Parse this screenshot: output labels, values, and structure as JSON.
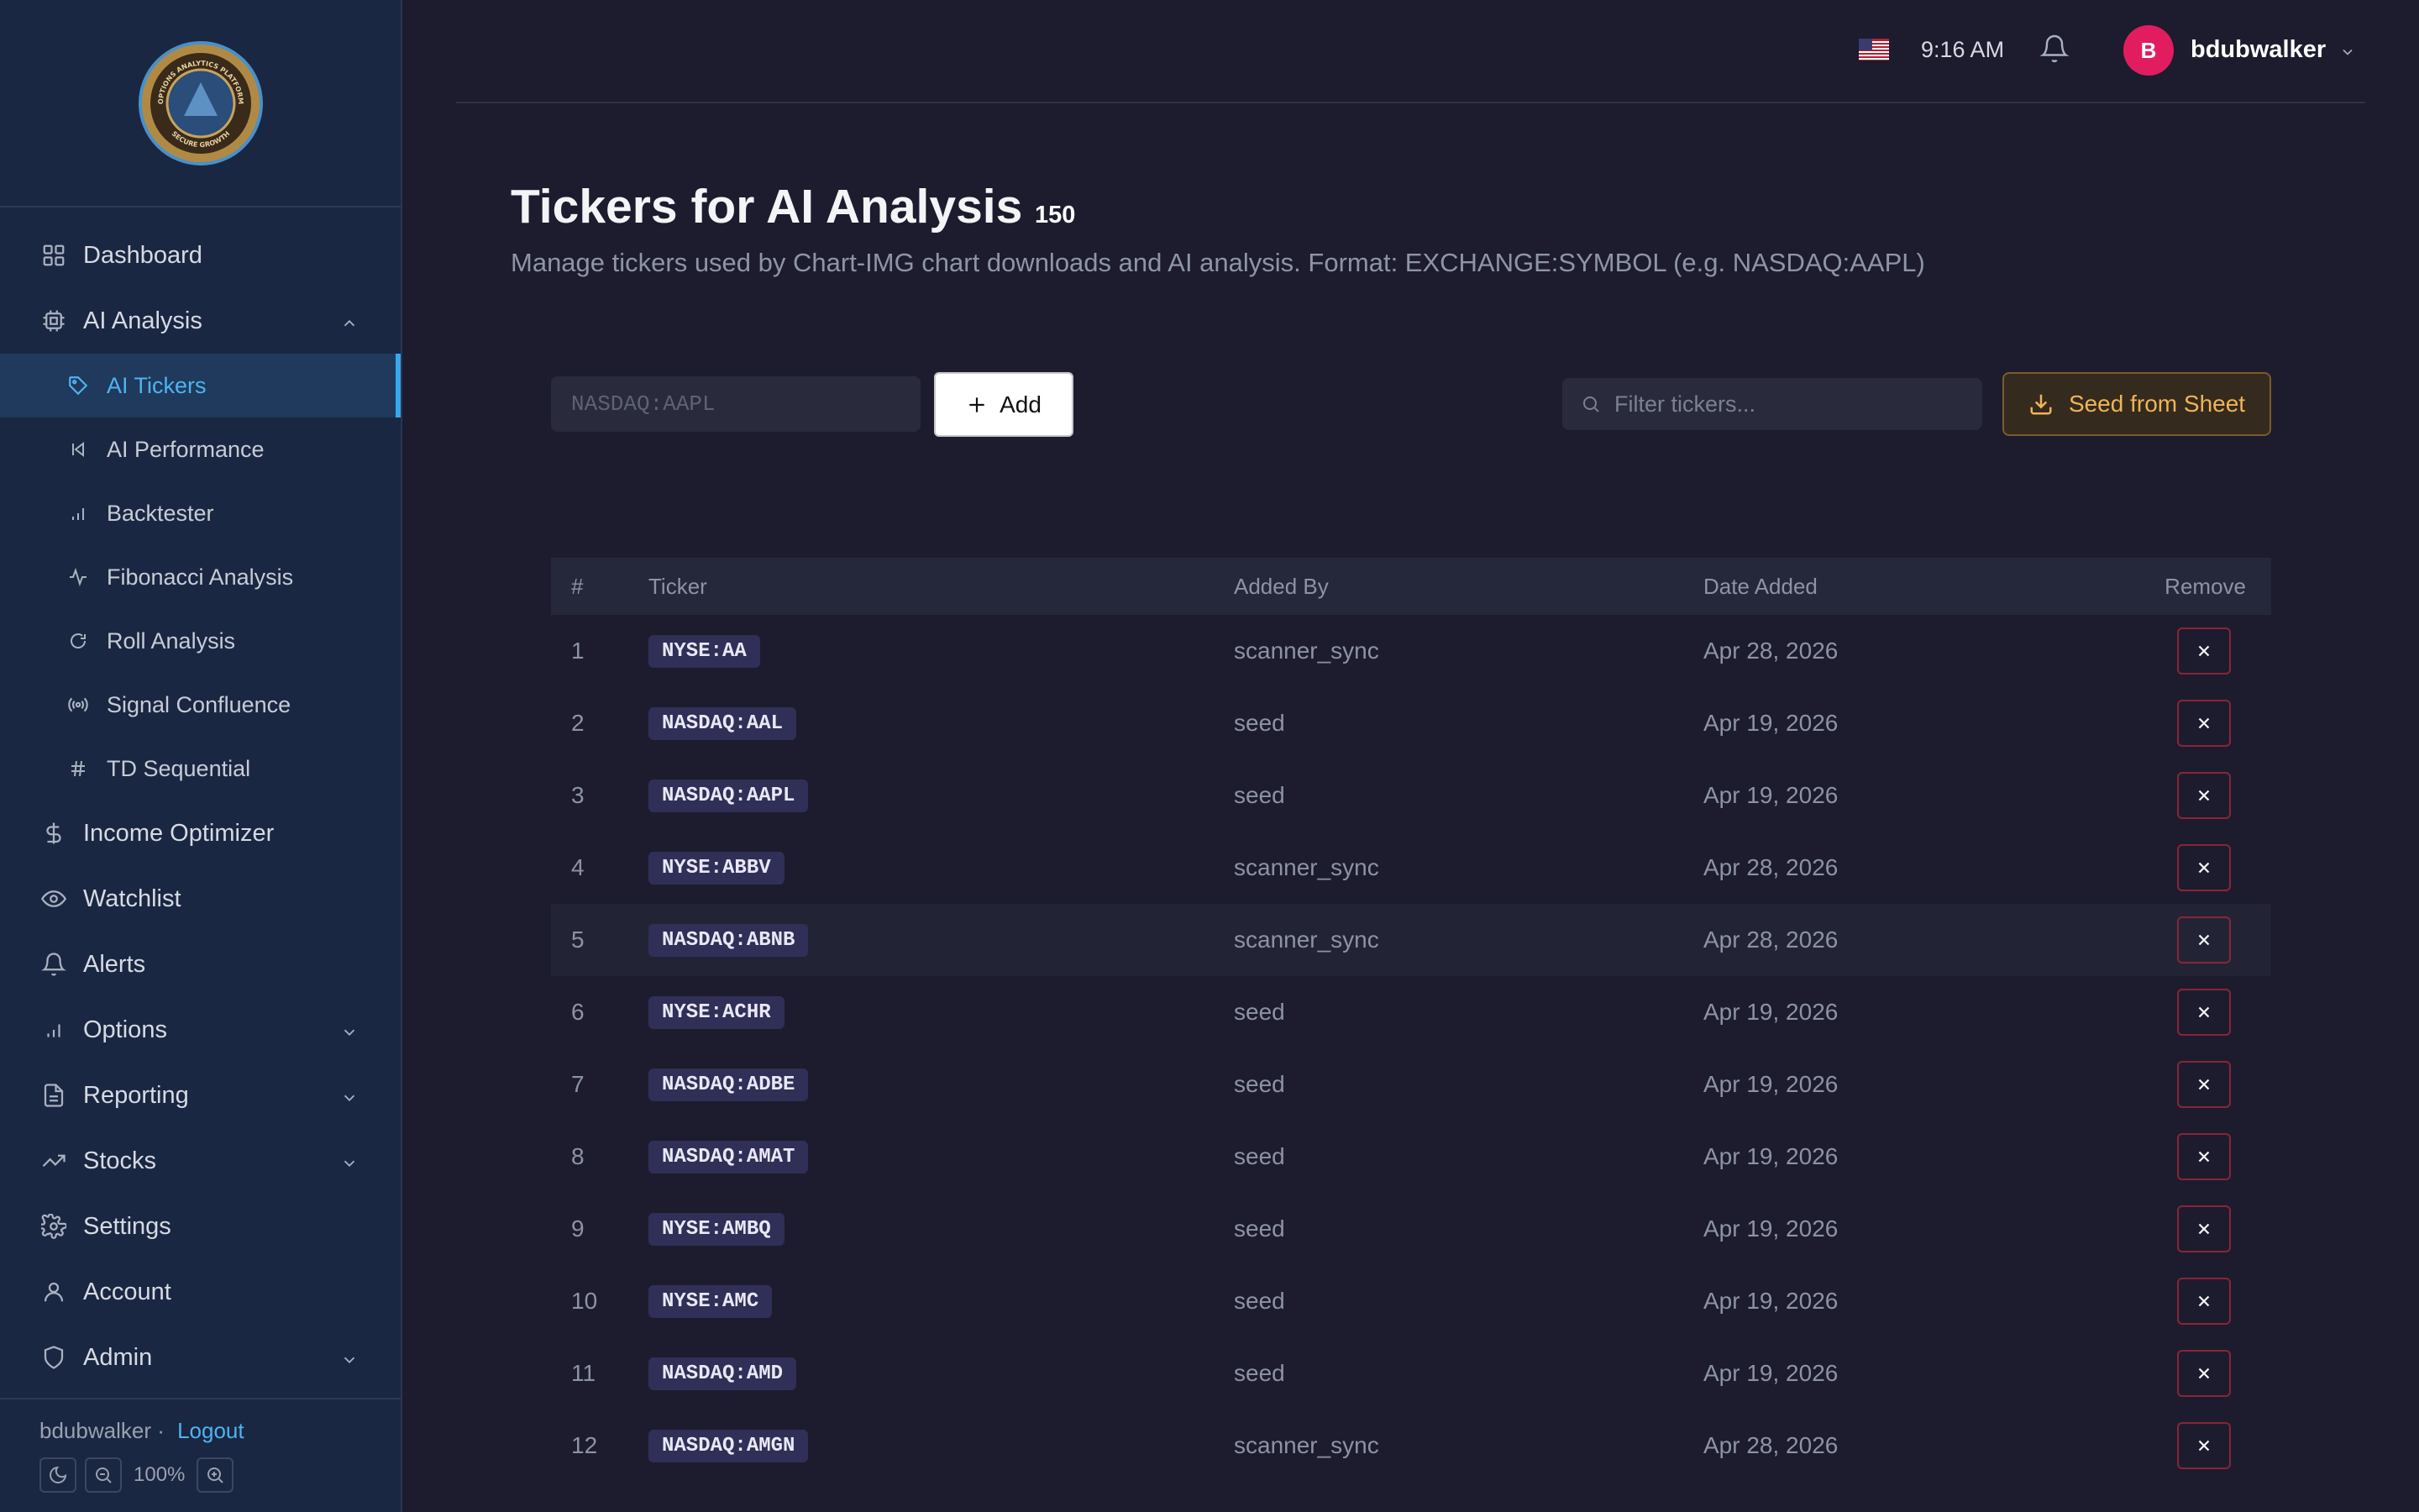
{
  "sidebar": {
    "logo_text": [
      "OPTIONS ANALYTICS PLATFORM",
      "SECURE GROWTH"
    ],
    "items": [
      {
        "label": "Dashboard",
        "icon": "grid-icon"
      },
      {
        "label": "AI Analysis",
        "icon": "cpu-icon",
        "expanded": true
      },
      {
        "label": "AI Tickers",
        "icon": "tag-icon",
        "active": true
      },
      {
        "label": "AI Performance",
        "icon": "rewind-icon"
      },
      {
        "label": "Backtester",
        "icon": "bar-chart-icon"
      },
      {
        "label": "Fibonacci Analysis",
        "icon": "pulse-icon"
      },
      {
        "label": "Roll Analysis",
        "icon": "refresh-icon"
      },
      {
        "label": "Signal Confluence",
        "icon": "broadcast-icon"
      },
      {
        "label": "TD Sequential",
        "icon": "hash-icon"
      },
      {
        "label": "Income Optimizer",
        "icon": "dollar-icon"
      },
      {
        "label": "Watchlist",
        "icon": "eye-icon"
      },
      {
        "label": "Alerts",
        "icon": "bell-icon"
      },
      {
        "label": "Options",
        "icon": "bar-chart-icon"
      },
      {
        "label": "Reporting",
        "icon": "document-icon"
      },
      {
        "label": "Stocks",
        "icon": "trend-up-icon"
      },
      {
        "label": "Settings",
        "icon": "gear-icon"
      },
      {
        "label": "Account",
        "icon": "user-icon"
      },
      {
        "label": "Admin",
        "icon": "shield-icon"
      }
    ],
    "footer": {
      "user": "bdubwalker ·",
      "logout": "Logout",
      "zoom": "100%"
    }
  },
  "topbar": {
    "time": "9:16 AM",
    "username": "bdubwalker",
    "avatar_initial": "B"
  },
  "main": {
    "title": "Tickers for AI Analysis",
    "count": "150",
    "description": "Manage tickers used by Chart-IMG chart downloads and AI analysis. Format: EXCHANGE:SYMBOL (e.g. NASDAQ:AAPL)",
    "ticker_placeholder": "NASDAQ:AAPL",
    "add_label": "Add",
    "filter_placeholder": "Filter tickers...",
    "seed_label": "Seed from Sheet"
  },
  "table": {
    "headers": [
      "#",
      "Ticker",
      "Added By",
      "Date Added",
      "Remove"
    ],
    "rows": [
      {
        "n": "1",
        "ticker": "NYSE:AA",
        "by": "scanner_sync",
        "date": "Apr 28, 2026"
      },
      {
        "n": "2",
        "ticker": "NASDAQ:AAL",
        "by": "seed",
        "date": "Apr 19, 2026"
      },
      {
        "n": "3",
        "ticker": "NASDAQ:AAPL",
        "by": "seed",
        "date": "Apr 19, 2026"
      },
      {
        "n": "4",
        "ticker": "NYSE:ABBV",
        "by": "scanner_sync",
        "date": "Apr 28, 2026"
      },
      {
        "n": "5",
        "ticker": "NASDAQ:ABNB",
        "by": "scanner_sync",
        "date": "Apr 28, 2026"
      },
      {
        "n": "6",
        "ticker": "NYSE:ACHR",
        "by": "seed",
        "date": "Apr 19, 2026"
      },
      {
        "n": "7",
        "ticker": "NASDAQ:ADBE",
        "by": "seed",
        "date": "Apr 19, 2026"
      },
      {
        "n": "8",
        "ticker": "NASDAQ:AMAT",
        "by": "seed",
        "date": "Apr 19, 2026"
      },
      {
        "n": "9",
        "ticker": "NYSE:AMBQ",
        "by": "seed",
        "date": "Apr 19, 2026"
      },
      {
        "n": "10",
        "ticker": "NYSE:AMC",
        "by": "seed",
        "date": "Apr 19, 2026"
      },
      {
        "n": "11",
        "ticker": "NASDAQ:AMD",
        "by": "seed",
        "date": "Apr 19, 2026"
      },
      {
        "n": "12",
        "ticker": "NASDAQ:AMGN",
        "by": "scanner_sync",
        "date": "Apr 28, 2026"
      }
    ]
  }
}
